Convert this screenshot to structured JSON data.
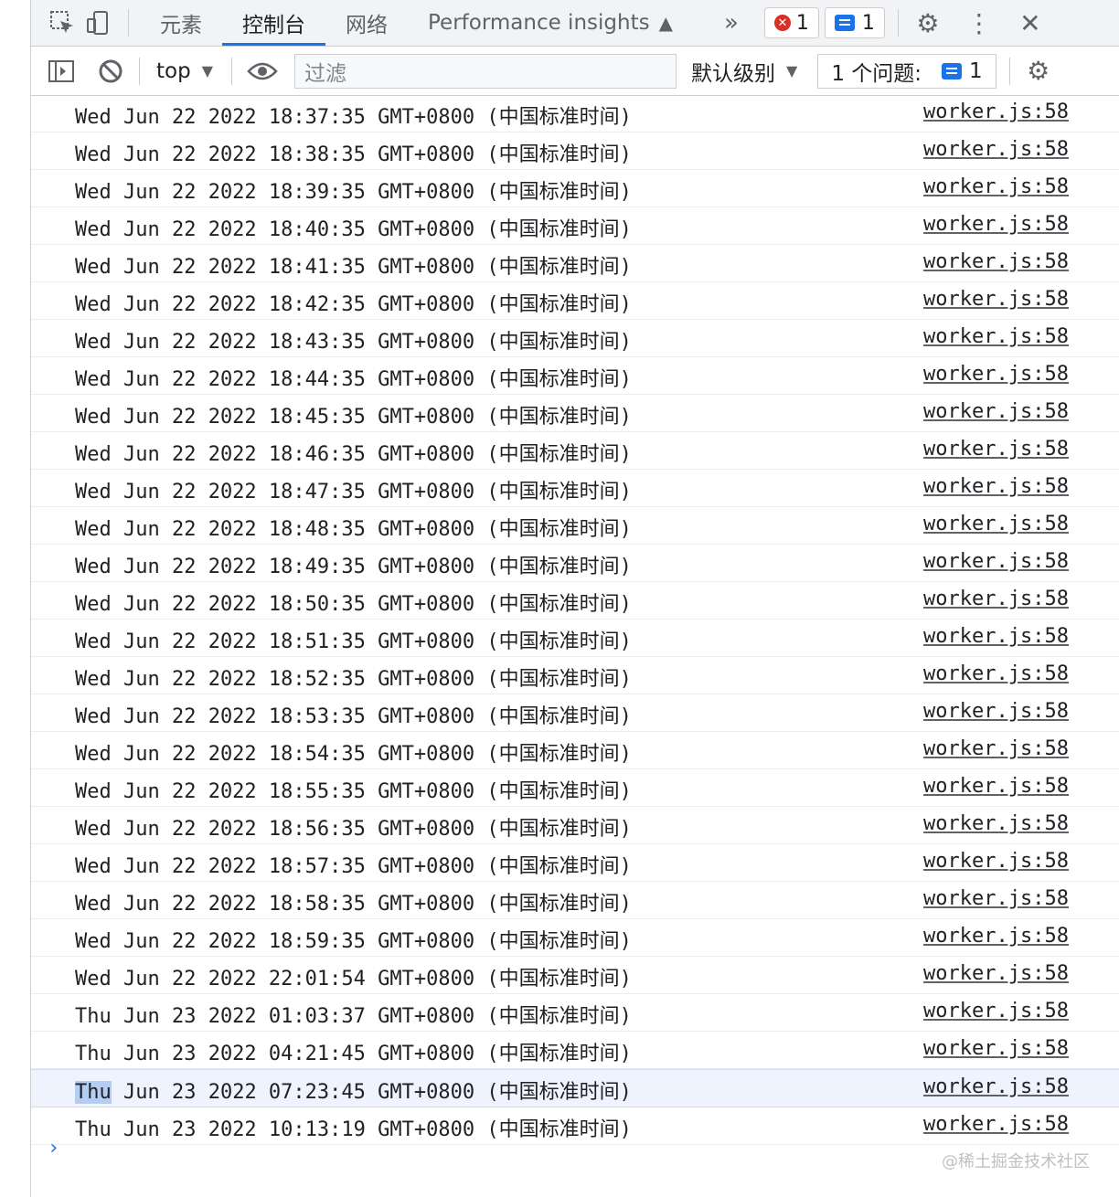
{
  "tabs": [
    "元素",
    "控制台",
    "网络",
    "Performance insights"
  ],
  "more_tabs_icon": "chevron-double-right-icon",
  "errors_count": "1",
  "messages_count": "1",
  "toolbar": {
    "context": "top",
    "filter_placeholder": "过滤",
    "levels": "默认级别",
    "issues_label": "1 个问题:",
    "issues_count": "1"
  },
  "logs": [
    {
      "msg": "Wed Jun 22 2022 18:37:35 GMT+0800 (中国标准时间)",
      "src": "worker.js:58"
    },
    {
      "msg": "Wed Jun 22 2022 18:38:35 GMT+0800 (中国标准时间)",
      "src": "worker.js:58"
    },
    {
      "msg": "Wed Jun 22 2022 18:39:35 GMT+0800 (中国标准时间)",
      "src": "worker.js:58"
    },
    {
      "msg": "Wed Jun 22 2022 18:40:35 GMT+0800 (中国标准时间)",
      "src": "worker.js:58"
    },
    {
      "msg": "Wed Jun 22 2022 18:41:35 GMT+0800 (中国标准时间)",
      "src": "worker.js:58"
    },
    {
      "msg": "Wed Jun 22 2022 18:42:35 GMT+0800 (中国标准时间)",
      "src": "worker.js:58"
    },
    {
      "msg": "Wed Jun 22 2022 18:43:35 GMT+0800 (中国标准时间)",
      "src": "worker.js:58"
    },
    {
      "msg": "Wed Jun 22 2022 18:44:35 GMT+0800 (中国标准时间)",
      "src": "worker.js:58"
    },
    {
      "msg": "Wed Jun 22 2022 18:45:35 GMT+0800 (中国标准时间)",
      "src": "worker.js:58"
    },
    {
      "msg": "Wed Jun 22 2022 18:46:35 GMT+0800 (中国标准时间)",
      "src": "worker.js:58"
    },
    {
      "msg": "Wed Jun 22 2022 18:47:35 GMT+0800 (中国标准时间)",
      "src": "worker.js:58"
    },
    {
      "msg": "Wed Jun 22 2022 18:48:35 GMT+0800 (中国标准时间)",
      "src": "worker.js:58"
    },
    {
      "msg": "Wed Jun 22 2022 18:49:35 GMT+0800 (中国标准时间)",
      "src": "worker.js:58"
    },
    {
      "msg": "Wed Jun 22 2022 18:50:35 GMT+0800 (中国标准时间)",
      "src": "worker.js:58"
    },
    {
      "msg": "Wed Jun 22 2022 18:51:35 GMT+0800 (中国标准时间)",
      "src": "worker.js:58"
    },
    {
      "msg": "Wed Jun 22 2022 18:52:35 GMT+0800 (中国标准时间)",
      "src": "worker.js:58"
    },
    {
      "msg": "Wed Jun 22 2022 18:53:35 GMT+0800 (中国标准时间)",
      "src": "worker.js:58"
    },
    {
      "msg": "Wed Jun 22 2022 18:54:35 GMT+0800 (中国标准时间)",
      "src": "worker.js:58"
    },
    {
      "msg": "Wed Jun 22 2022 18:55:35 GMT+0800 (中国标准时间)",
      "src": "worker.js:58"
    },
    {
      "msg": "Wed Jun 22 2022 18:56:35 GMT+0800 (中国标准时间)",
      "src": "worker.js:58"
    },
    {
      "msg": "Wed Jun 22 2022 18:57:35 GMT+0800 (中国标准时间)",
      "src": "worker.js:58"
    },
    {
      "msg": "Wed Jun 22 2022 18:58:35 GMT+0800 (中国标准时间)",
      "src": "worker.js:58"
    },
    {
      "msg": "Wed Jun 22 2022 18:59:35 GMT+0800 (中国标准时间)",
      "src": "worker.js:58"
    },
    {
      "msg": "Wed Jun 22 2022 22:01:54 GMT+0800 (中国标准时间)",
      "src": "worker.js:58"
    },
    {
      "msg": "Thu Jun 23 2022 01:03:37 GMT+0800 (中国标准时间)",
      "src": "worker.js:58"
    },
    {
      "msg": "Thu Jun 23 2022 04:21:45 GMT+0800 (中国标准时间)",
      "src": "worker.js:58"
    },
    {
      "msg_highlight": "Thu",
      "msg": " Jun 23 2022 07:23:45 GMT+0800 (中国标准时间)",
      "src": "worker.js:58",
      "selected": true
    },
    {
      "msg": "Thu Jun 23 2022 10:13:19 GMT+0800 (中国标准时间)",
      "src": "worker.js:58"
    }
  ],
  "prompt_symbol": "›",
  "watermark": "@稀土掘金技术社区"
}
